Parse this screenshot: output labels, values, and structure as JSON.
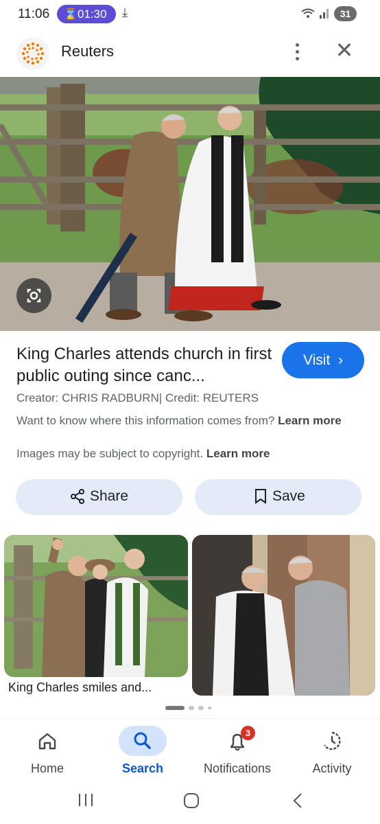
{
  "status_bar": {
    "time": "11:06",
    "timer": "01:30",
    "battery": "31"
  },
  "header": {
    "title": "Reuters"
  },
  "article": {
    "title": "King Charles attends church in first public outing since canc...",
    "visit_label": "Visit",
    "credit": "Creator: CHRIS RADBURN| Credit: REUTERS",
    "info_text": "Want to know where this information comes from?",
    "info_link": "Learn more",
    "copyright_text": "Images may be subject to copyright.",
    "copyright_link": "Learn more"
  },
  "actions": {
    "share_label": "Share",
    "save_label": "Save"
  },
  "related": {
    "items": [
      {
        "caption": "King Charles smiles and..."
      },
      {
        "caption": ""
      }
    ]
  },
  "bottom_nav": {
    "items": [
      {
        "label": "Home",
        "icon": "home-icon"
      },
      {
        "label": "Search",
        "icon": "search-icon",
        "active": true
      },
      {
        "label": "Notifications",
        "icon": "bell-icon",
        "badge": "3"
      },
      {
        "label": "Activity",
        "icon": "activity-icon"
      }
    ]
  },
  "colors": {
    "accent": "#1a73e8",
    "active_nav": "#0b57d0",
    "timer_chip": "#5b4bd6",
    "badge": "#d93025",
    "button_bg": "#e3ebf8"
  }
}
